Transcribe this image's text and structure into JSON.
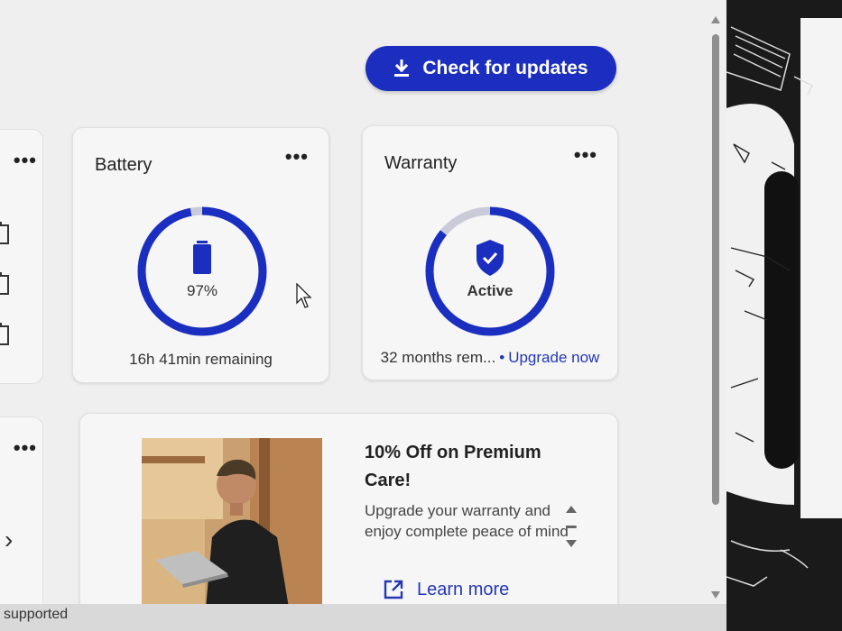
{
  "toolbar": {
    "check_updates_label": "Check for updates"
  },
  "battery": {
    "title": "Battery",
    "more_label": "•••",
    "percent_text": "97%",
    "level": 0.97,
    "remaining_text": "16h 41min remaining",
    "accent": "#1a2fc0",
    "track": "#c9ccd8"
  },
  "warranty": {
    "title": "Warranty",
    "more_label": "•••",
    "status_text": "Active",
    "fraction_remaining": 0.86,
    "remaining_text": "32 months rem...",
    "separator": "•",
    "upgrade_link": "Upgrade now",
    "accent": "#1a2fc0",
    "track": "#c9ccd8"
  },
  "promo": {
    "title": "10% Off on Premium Care!",
    "body": "Upgrade your warranty and enjoy complete peace of mind",
    "learn_more": "Learn more"
  },
  "left_cards": {
    "more_label": "•••",
    "chevron": "›"
  },
  "status_bar": {
    "text": "supported"
  },
  "colors": {
    "primary": "#1b2ebf",
    "link": "#2437b8",
    "panel_bg": "#efefef"
  }
}
